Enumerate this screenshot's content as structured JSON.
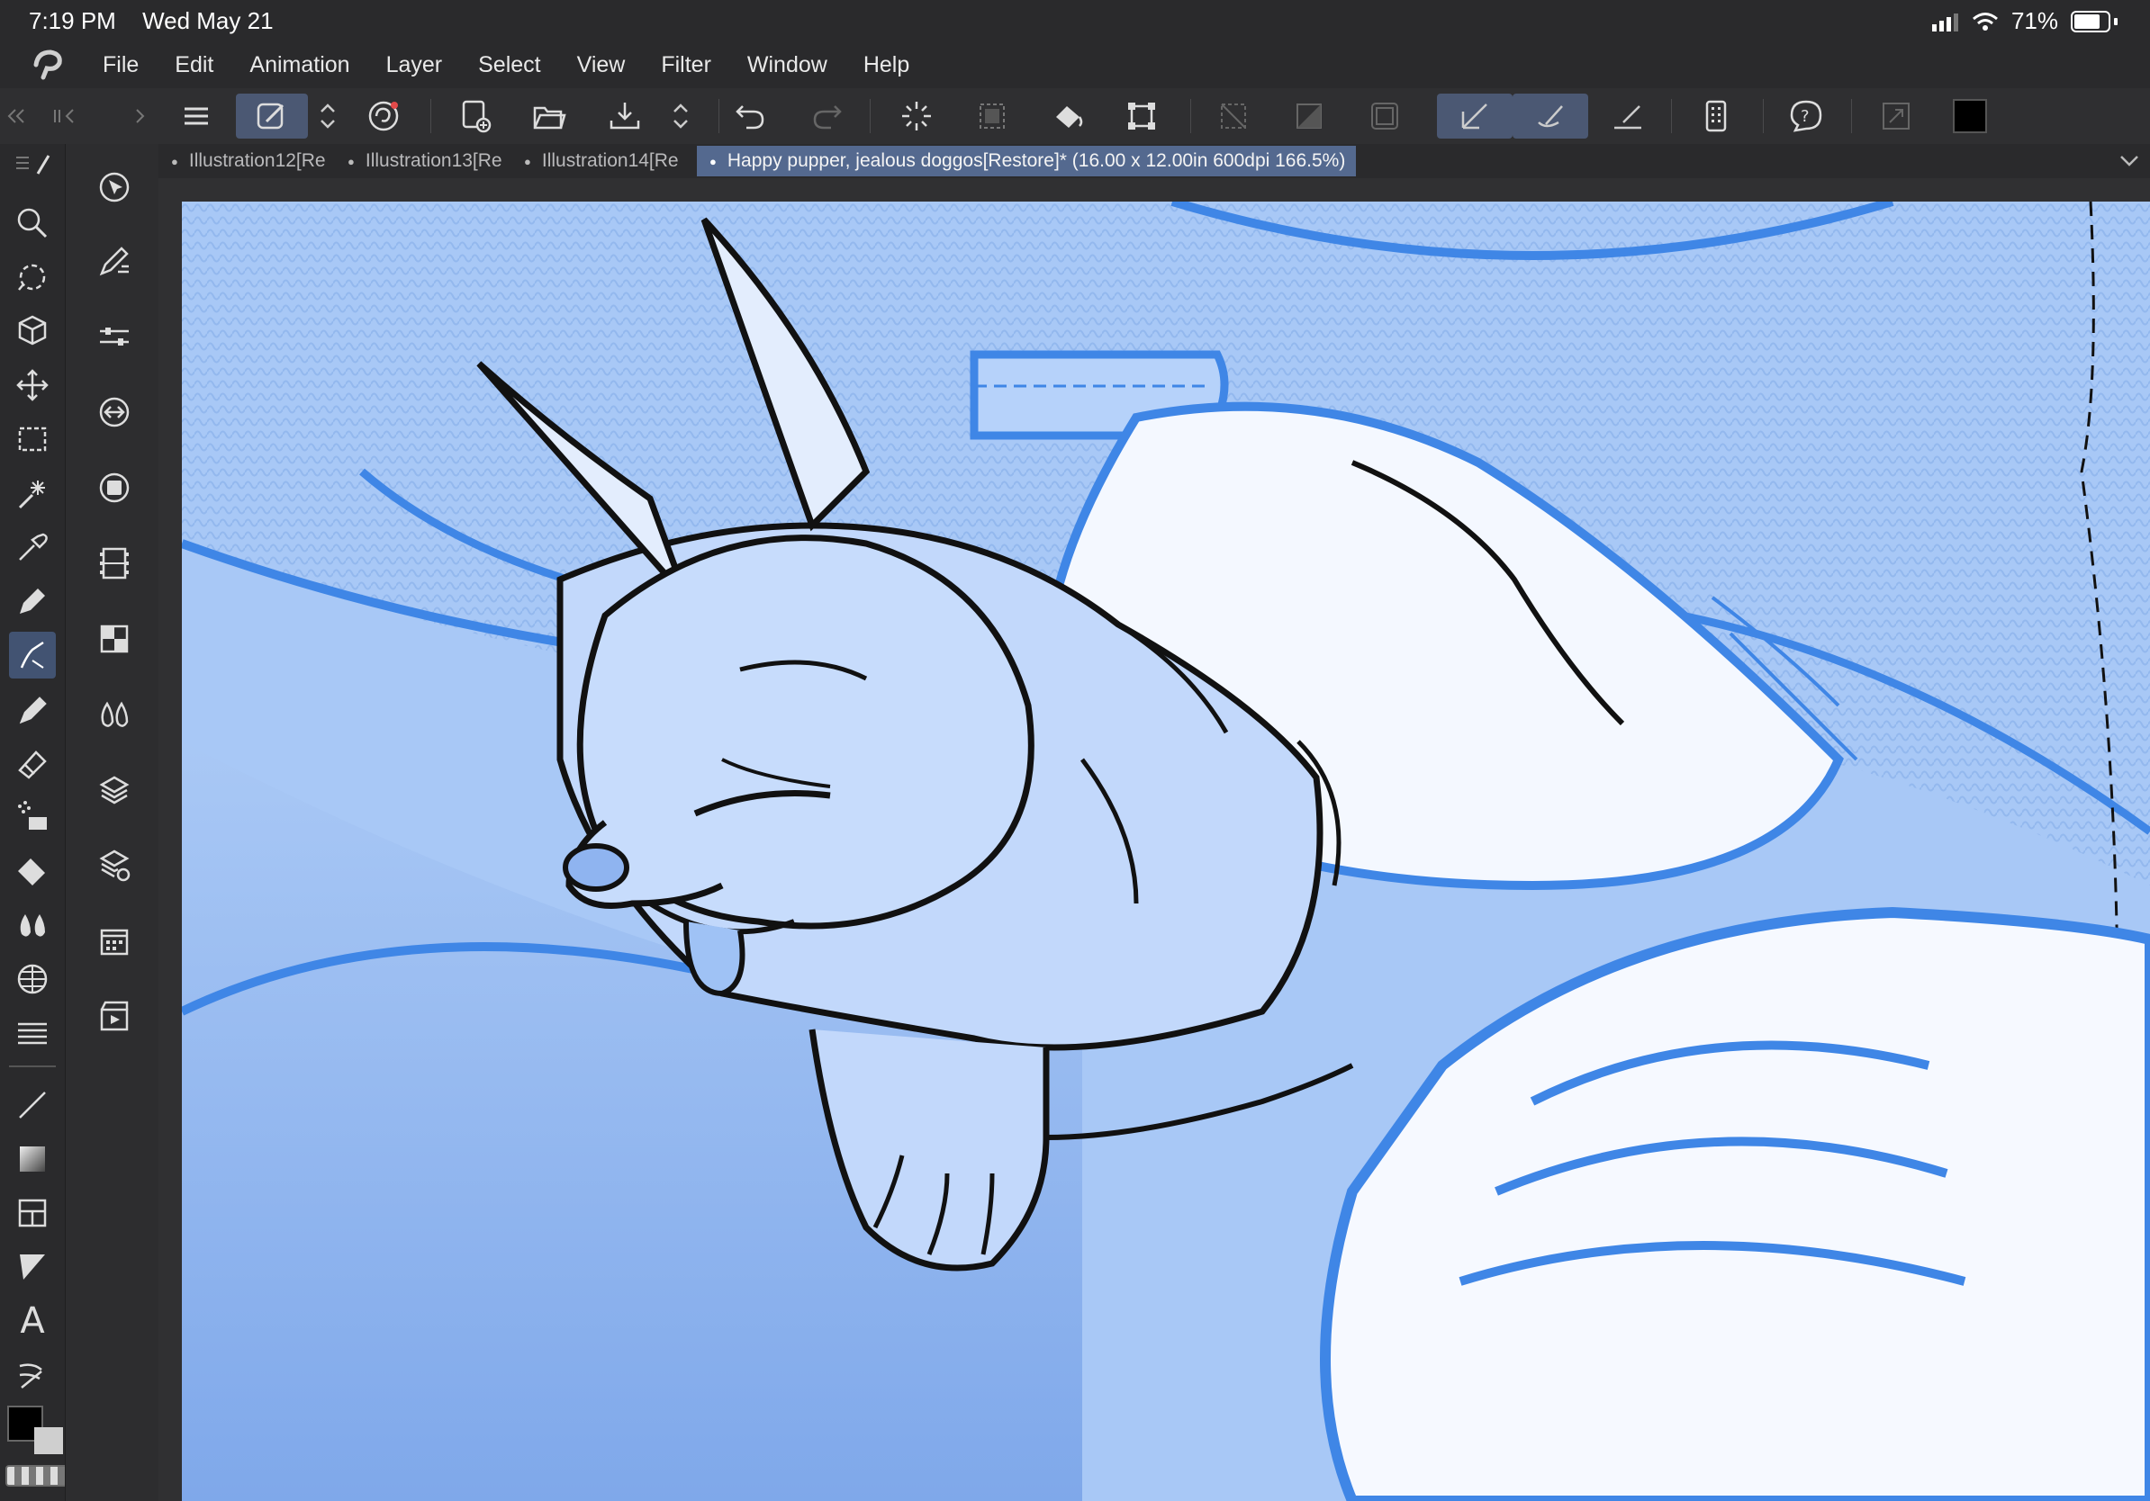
{
  "status": {
    "time": "7:19 PM",
    "date": "Wed May 21",
    "battery": "71%"
  },
  "menu": [
    "File",
    "Edit",
    "Animation",
    "Layer",
    "Select",
    "View",
    "Filter",
    "Window",
    "Help"
  ],
  "tabs": [
    {
      "label": "Illustration12[Re"
    },
    {
      "label": "Illustration13[Re"
    },
    {
      "label": "Illustration14[Re"
    },
    {
      "label": "Happy pupper, jealous doggos[Restore]* (16.00 x 12.00in 600dpi 166.5%)"
    }
  ],
  "tools": {
    "text_glyph": "A"
  },
  "colors": {
    "accent": "#4b5873",
    "canvas_blue": "#9fc2f5",
    "line_blue": "#3f86e6",
    "main_color": "#000000",
    "sub_color": "#cfcfcf"
  }
}
